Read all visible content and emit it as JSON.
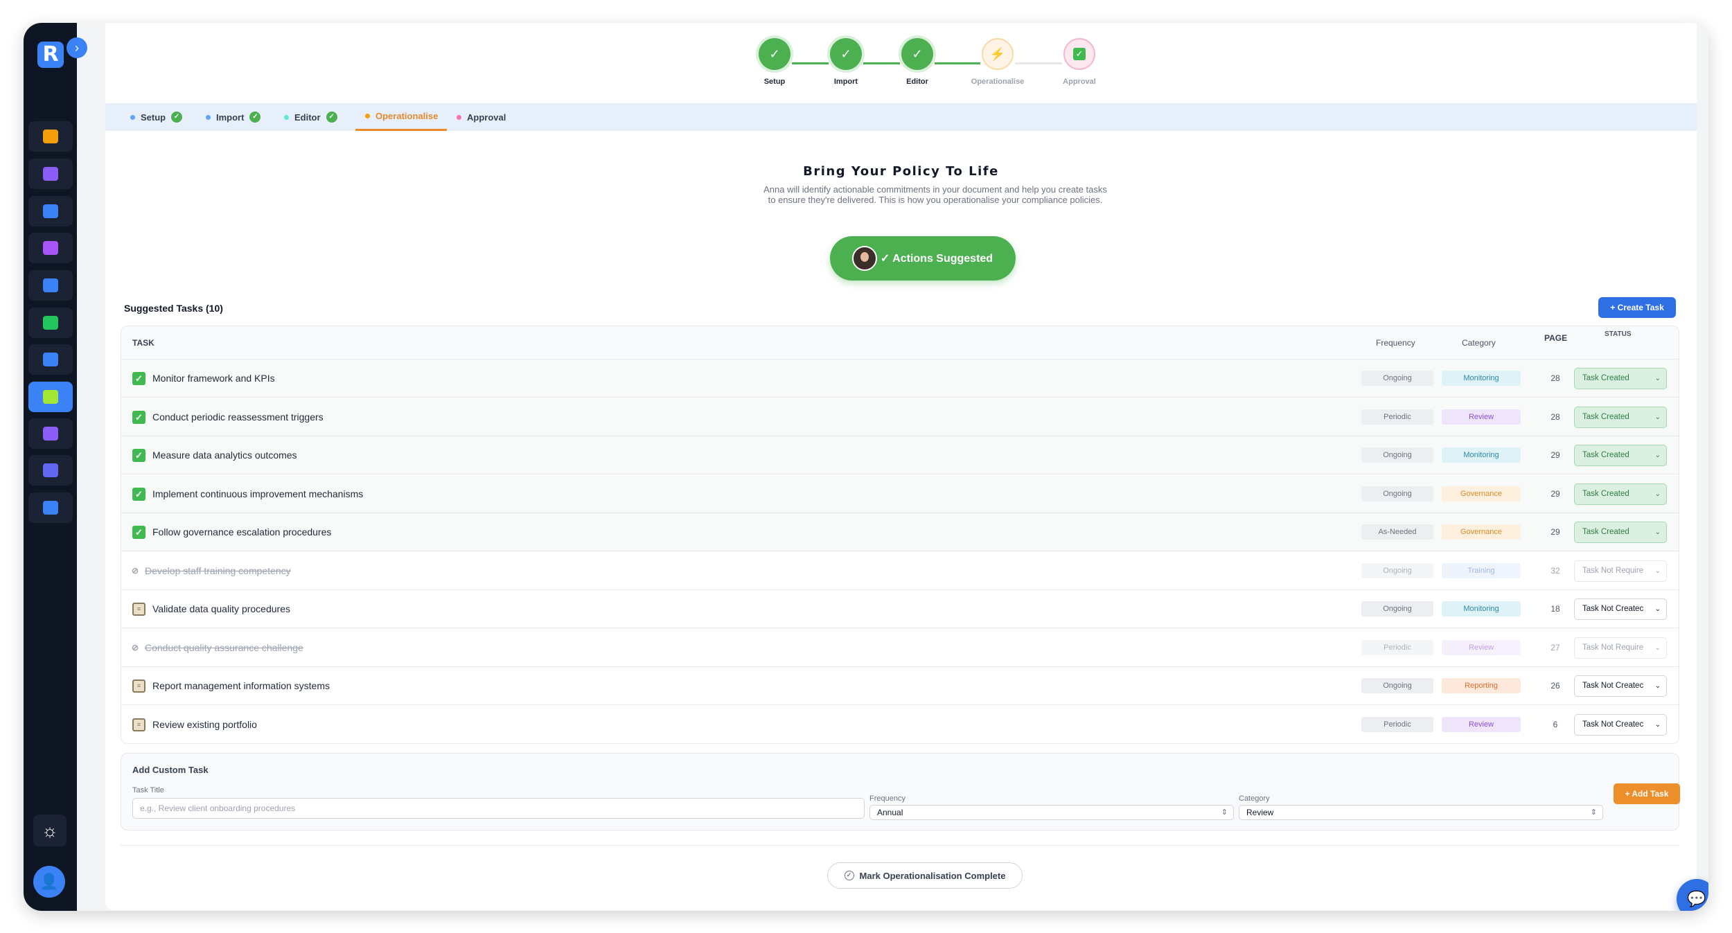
{
  "brand": {
    "logo_letter": "R",
    "accent": "#3b82f6"
  },
  "stepper": [
    {
      "label": "Setup",
      "state": "done"
    },
    {
      "label": "Import",
      "state": "done"
    },
    {
      "label": "Editor",
      "state": "done"
    },
    {
      "label": "Operationalise",
      "state": "current"
    },
    {
      "label": "Approval",
      "state": "pending"
    }
  ],
  "tabs": [
    {
      "label": "Setup",
      "done": true,
      "dot": "#60a5fa"
    },
    {
      "label": "Import",
      "done": true,
      "dot": "#60a5fa"
    },
    {
      "label": "Editor",
      "done": true,
      "dot": "#5eead4"
    },
    {
      "label": "Operationalise",
      "done": false,
      "dot": "#f59e0b",
      "active": true
    },
    {
      "label": "Approval",
      "done": false,
      "dot": "#f472b6"
    }
  ],
  "hero": {
    "title": "Bring Your Policy To Life",
    "description": "Anna will identify actionable commitments in your document and help you create tasks to ensure they're delivered. This is how you operationalise your compliance policies.",
    "actions_label": "✓ Actions Suggested"
  },
  "tasks_header": {
    "title": "Suggested Tasks (10)",
    "create_label": "+  Create Task"
  },
  "table": {
    "columns": {
      "task": "TASK",
      "frequency": "Frequency",
      "category": "Category",
      "page": "PAGE",
      "status": "STATUS"
    },
    "rows": [
      {
        "title": "Monitor framework and KPIs",
        "frequency": "Ongoing",
        "category": "Monitoring",
        "page": "28",
        "status": "Task Created",
        "state": "created"
      },
      {
        "title": "Conduct periodic reassessment triggers",
        "frequency": "Periodic",
        "category": "Review",
        "page": "28",
        "status": "Task Created",
        "state": "created"
      },
      {
        "title": "Measure data analytics outcomes",
        "frequency": "Ongoing",
        "category": "Monitoring",
        "page": "29",
        "status": "Task Created",
        "state": "created"
      },
      {
        "title": "Implement continuous improvement mechanisms",
        "frequency": "Ongoing",
        "category": "Governance",
        "page": "29",
        "status": "Task Created",
        "state": "created"
      },
      {
        "title": "Follow governance escalation procedures",
        "frequency": "As-Needed",
        "category": "Governance",
        "page": "29",
        "status": "Task Created",
        "state": "created"
      },
      {
        "title": "Develop staff training competency",
        "frequency": "Ongoing",
        "category": "Training",
        "page": "32",
        "status": "Task Not Require",
        "state": "notr"
      },
      {
        "title": "Validate data quality procedures",
        "frequency": "Ongoing",
        "category": "Monitoring",
        "page": "18",
        "status": "Task Not Createc",
        "state": "notc"
      },
      {
        "title": "Conduct quality assurance challenge",
        "frequency": "Periodic",
        "category": "Review",
        "page": "27",
        "status": "Task Not Require",
        "state": "notr"
      },
      {
        "title": "Report management information systems",
        "frequency": "Ongoing",
        "category": "Reporting",
        "page": "26",
        "status": "Task Not Createc",
        "state": "notc"
      },
      {
        "title": "Review existing portfolio",
        "frequency": "Periodic",
        "category": "Review",
        "page": "6",
        "status": "Task Not Createc",
        "state": "notc"
      }
    ]
  },
  "custom_task": {
    "heading": "Add Custom Task",
    "title_label": "Task Title",
    "title_placeholder": "e.g., Review client onboarding procedures",
    "frequency_label": "Frequency",
    "frequency_value": "Annual",
    "category_label": "Category",
    "category_value": "Review",
    "add_label": "+ Add Task"
  },
  "mark_complete_label": "Mark Operationalisation Complete",
  "sidebar_icons": [
    {
      "name": "building-icon",
      "color": "#f59e0b"
    },
    {
      "name": "team-icon",
      "color": "#8b5cf6"
    },
    {
      "name": "shield-icon",
      "color": "#3b82f6"
    },
    {
      "name": "document-check-icon",
      "color": "#a855f7"
    },
    {
      "name": "id-card-icon",
      "color": "#3b82f6"
    },
    {
      "name": "card-icon",
      "color": "#22c55e"
    },
    {
      "name": "chart-icon",
      "color": "#3b82f6"
    },
    {
      "name": "policy-edit-icon",
      "color": "#a3e635",
      "active": true
    },
    {
      "name": "list-icon",
      "color": "#8b5cf6"
    },
    {
      "name": "target-icon",
      "color": "#6366f1"
    },
    {
      "name": "presentation-icon",
      "color": "#3b82f6"
    }
  ]
}
